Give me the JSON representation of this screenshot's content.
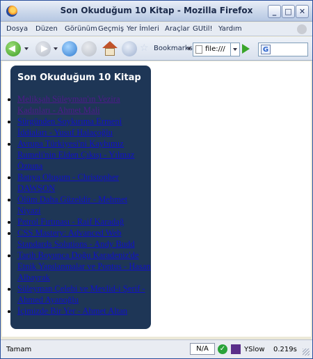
{
  "window": {
    "title": "Son Okuduğum 10 Kitap - Mozilla Firefox"
  },
  "menu": [
    "Dosya",
    "Düzen",
    "Görünüm",
    "Geçmiş",
    "Yer İmleri",
    "Araçlar",
    "GUtil!",
    "Yardım"
  ],
  "toolbar": {
    "bookmarks_label": "Bookmarks",
    "url": "file:///",
    "search_value": ""
  },
  "panel": {
    "title": "Son Okuduğum 10 Kitap",
    "background_color": "#1e3656",
    "books": [
      "Melikşah Süleyman'ın Vezira Kadınları - Ahmet Mali",
      "Sürgünden Soykırıma Ermeni İddiaları - Yusuf Halaçoğlu",
      "Avrupa Türkiyesi'ni Kaybımız Rumeli'nin Elden Çıkışı - Yılmaz Öztuna",
      "Batıya Oluşum - Christopher DAWSON",
      "Ölüm Daha Güzeldir - Mehmet Niyazi",
      "Petrol Fırtınası - Raif Karadağ",
      "CSS Mastery: Advanced Web Standards Solutions - Andy Budd",
      "Tarih Boyunca Doğu Karadeniz'de Etnik Yapılanmalar ve Pontus - Hasan Albayrak",
      "Süleyman Çelebi ve Mevlid-i Şerif - Ahmed Ayanoğlu",
      "İçimizde Bir Yer - Ahmet Altan"
    ]
  },
  "status": {
    "text": "Tamam",
    "na_label": "N/A",
    "yslow_label": "YSlow",
    "load_time": "0.219s"
  }
}
